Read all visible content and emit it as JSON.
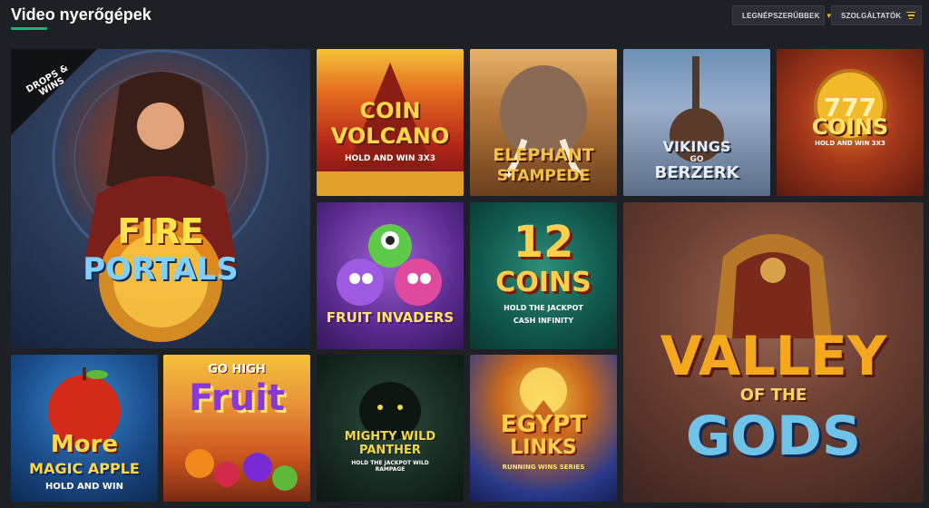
{
  "header": {
    "title": "Video nyerőgépek",
    "sort_label": "LEGNÉPSZERŰBBEK",
    "providers_label": "SZOLGÁLTATÓK"
  },
  "colors": {
    "accent_green": "#27b07a",
    "accent_yellow": "#f0b90b",
    "background": "#1d2024"
  },
  "games": [
    {
      "id": "fire",
      "badge": "DROPS & WINS",
      "line1": "FIRE",
      "line2": "PORTALS"
    },
    {
      "id": "volcano",
      "line1": "COIN",
      "line2": "VOLCANO",
      "sub": "HOLD AND WIN 3x3"
    },
    {
      "id": "elephant",
      "line1": "ELEPHANT",
      "line2": "STAMPEDE"
    },
    {
      "id": "vikings",
      "line1": "VIKINGS",
      "line2": "GO",
      "line3": "BERZERK"
    },
    {
      "id": "coins",
      "line1": "COINS",
      "sub": "HOLD AND WIN 3x3"
    },
    {
      "id": "fruitinv",
      "line1": "FRUIT INVADERS"
    },
    {
      "id": "12coins",
      "line1": "12",
      "line2": "COINS",
      "sub1": "HOLD THE JACKPOT",
      "sub2": "CASH INFINITY"
    },
    {
      "id": "valley",
      "line1": "VALLEY",
      "line2": "OF THE",
      "line3": "GODS"
    },
    {
      "id": "apple",
      "line1": "More",
      "line2": "MAGIC APPLE",
      "sub": "HOLD AND WIN"
    },
    {
      "id": "gohigh",
      "line1": "GO HIGH",
      "line2": "Fruit"
    },
    {
      "id": "panther",
      "line1": "MIGHTY WILD",
      "line2": "PANTHER",
      "sub": "HOLD THE JACKPOT WILD RAMPAGE"
    },
    {
      "id": "egypt",
      "line1": "EGYPT",
      "line2": "LINKS",
      "sub": "RUNNING WINS SERIES"
    }
  ]
}
